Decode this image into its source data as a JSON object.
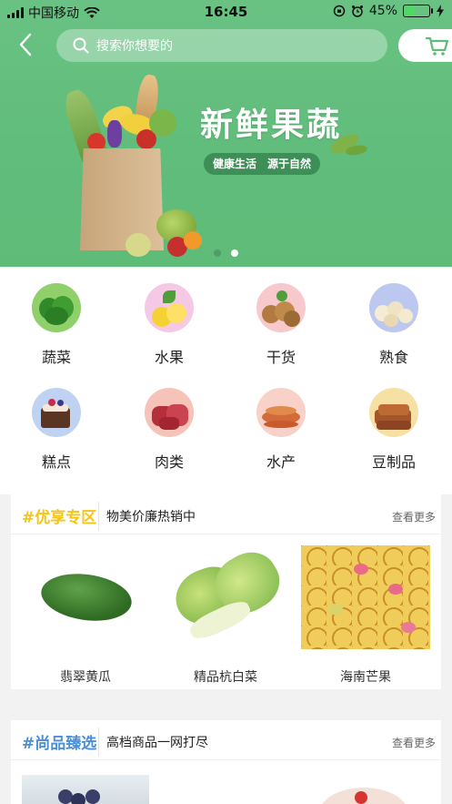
{
  "status_bar": {
    "carrier": "中国移动",
    "time": "16:45",
    "battery": "45%",
    "battery_level": 0.45
  },
  "header": {
    "search_placeholder": "搜索你想要的"
  },
  "banner": {
    "title": "新鲜果蔬",
    "subtitle": "健康生活　源于自然",
    "slides": 2,
    "active_slide": 2
  },
  "categories": [
    {
      "label": "蔬菜",
      "icon": "vegetables-icon"
    },
    {
      "label": "水果",
      "icon": "fruit-icon"
    },
    {
      "label": "干货",
      "icon": "dried-goods-icon"
    },
    {
      "label": "熟食",
      "icon": "cooked-food-icon"
    },
    {
      "label": "糕点",
      "icon": "pastry-icon"
    },
    {
      "label": "肉类",
      "icon": "meat-icon"
    },
    {
      "label": "水产",
      "icon": "seafood-icon"
    },
    {
      "label": "豆制品",
      "icon": "tofu-icon"
    }
  ],
  "section1": {
    "tag": "#优享专区",
    "tag_color": "#f5c518",
    "description": "物美价廉热销中",
    "more": "查看更多",
    "products": [
      {
        "name": "翡翠黄瓜"
      },
      {
        "name": "精品杭白菜"
      },
      {
        "name": "海南芒果"
      }
    ]
  },
  "section2": {
    "tag": "#尚品臻选",
    "tag_color": "#4a8fd8",
    "description": "高档商品一网打尽",
    "more": "查看更多"
  },
  "colors": {
    "brand_green": "#61bd7b",
    "active_dot": "#ffffff",
    "inactive_dot": "#4f9e67"
  }
}
